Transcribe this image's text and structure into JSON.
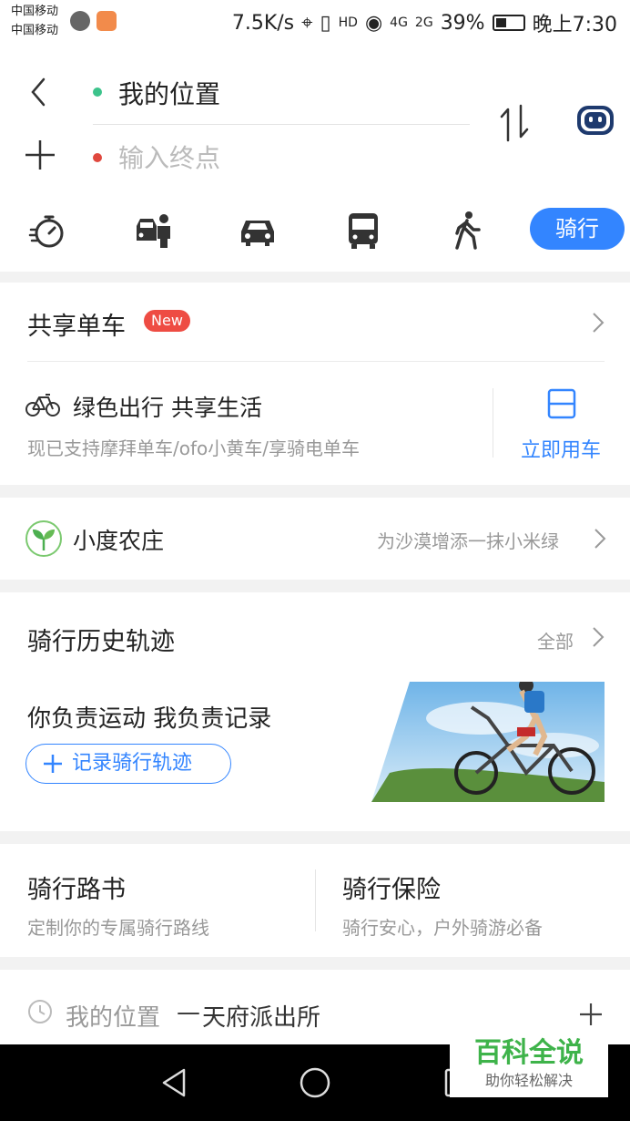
{
  "status_bar": {
    "carrier_1": "中国移动",
    "carrier_2": "中国移动",
    "speed": "7.5K/s",
    "net_1": "4G",
    "net_2": "2G",
    "battery": "39%",
    "time": "晚上7:30"
  },
  "route": {
    "origin": "我的位置",
    "destination_placeholder": "输入终点"
  },
  "modes": {
    "icons": [
      "timer-icon",
      "taxi-icon",
      "car-icon",
      "bus-icon",
      "walk-icon"
    ],
    "active_label": "骑行"
  },
  "share_bike": {
    "title": "共享单车",
    "badge": "New",
    "slogan": "绿色出行 共享生活",
    "support_text": "现已支持摩拜单车/ofo小黄车/享骑电单车",
    "cta": "立即用车"
  },
  "farm": {
    "title": "小度农庄",
    "hint": "为沙漠增添一抹小米绿"
  },
  "history": {
    "title": "骑行历史轨迹",
    "all_label": "全部",
    "slogan": "你负责运动 我负责记录",
    "record_button": "记录骑行轨迹"
  },
  "features": {
    "route_book_title": "骑行路书",
    "route_book_sub": "定制你的专属骑行路线",
    "insurance_title": "骑行保险",
    "insurance_sub": "骑行安心，户外骑游必备"
  },
  "recent": {
    "prefix": "我的位置",
    "separator": "—",
    "place": "天府派出所"
  },
  "watermark": {
    "title": "百科全说",
    "subtitle": "助你轻松解决"
  },
  "colors": {
    "accent": "#3385ff",
    "origin_dot": "#3cc38b",
    "dest_dot": "#e0483e",
    "badge": "#ee4c43"
  }
}
